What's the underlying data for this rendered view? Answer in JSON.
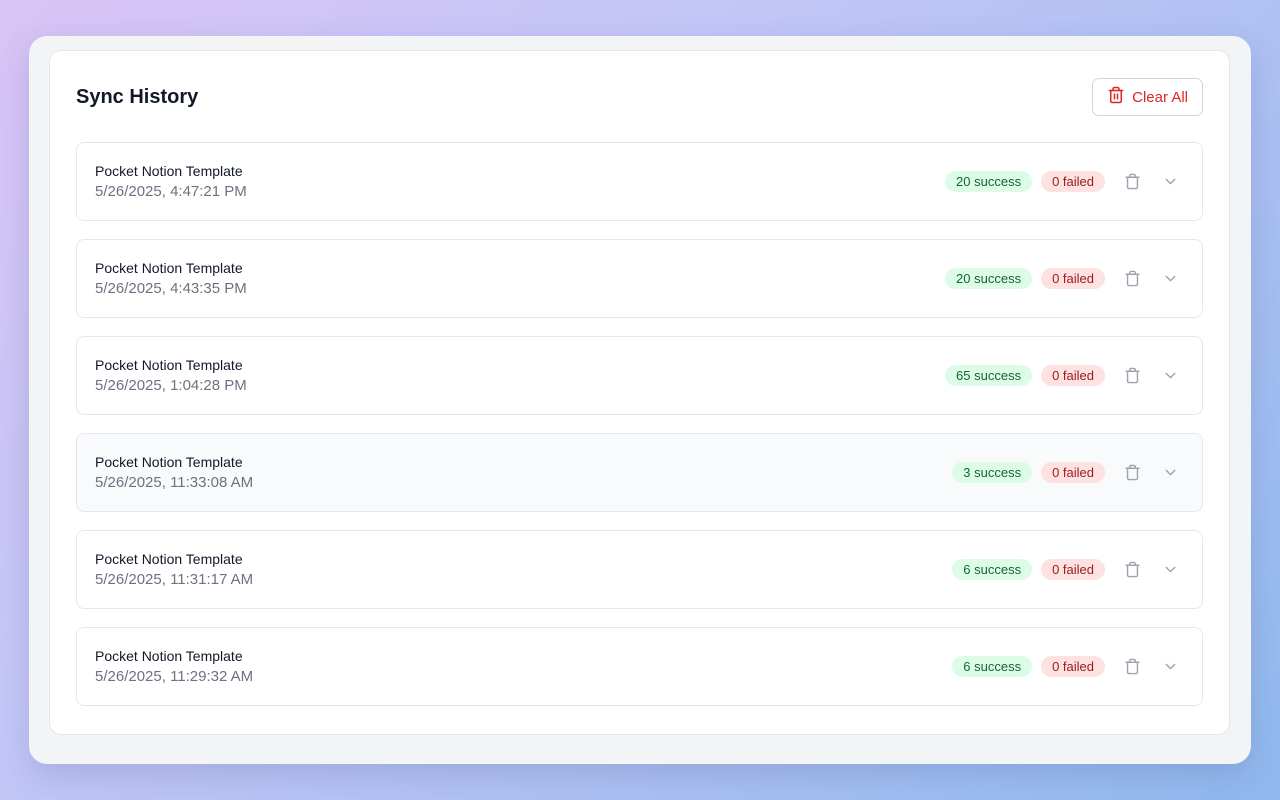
{
  "header": {
    "title": "Sync History",
    "clear_all_label": "Clear All"
  },
  "colors": {
    "danger": "#dc2626",
    "success_bg": "#dcfce7",
    "success_text": "#166534",
    "failed_bg": "#fee2e2",
    "failed_text": "#991b1b"
  },
  "icons": {
    "clear_all": "trash-icon",
    "row_delete": "trash-icon",
    "row_expand": "chevron-down-icon"
  },
  "sync_entries": [
    {
      "name": "Pocket Notion Template",
      "date": "5/26/2025, 4:47:21 PM",
      "success": "20 success",
      "failed": "0 failed"
    },
    {
      "name": "Pocket Notion Template",
      "date": "5/26/2025, 4:43:35 PM",
      "success": "20 success",
      "failed": "0 failed"
    },
    {
      "name": "Pocket Notion Template",
      "date": "5/26/2025, 1:04:28 PM",
      "success": "65 success",
      "failed": "0 failed"
    },
    {
      "name": "Pocket Notion Template",
      "date": "5/26/2025, 11:33:08 AM",
      "success": "3 success",
      "failed": "0 failed"
    },
    {
      "name": "Pocket Notion Template",
      "date": "5/26/2025, 11:31:17 AM",
      "success": "6 success",
      "failed": "0 failed"
    },
    {
      "name": "Pocket Notion Template",
      "date": "5/26/2025, 11:29:32 AM",
      "success": "6 success",
      "failed": "0 failed"
    }
  ]
}
